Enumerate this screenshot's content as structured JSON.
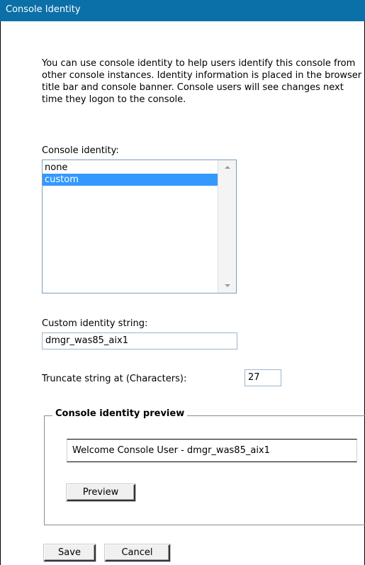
{
  "window": {
    "title": "Console Identity"
  },
  "intro_text": "You can use console identity to help users identify this console from other console instances. Identity information is placed in the browser title bar and console banner. Console users will see changes next time they logon to the console.",
  "identity": {
    "label": "Console identity:",
    "options": [
      "none",
      "custom"
    ],
    "selected": "custom"
  },
  "custom_string": {
    "label": "Custom identity string:",
    "value": "dmgr_was85_aix1"
  },
  "truncate": {
    "label": "Truncate string at (Characters):",
    "value": "27"
  },
  "preview": {
    "legend": "Console identity preview",
    "text": "Welcome Console User - dmgr_was85_aix1",
    "button_label": "Preview"
  },
  "actions": {
    "save_label": "Save",
    "cancel_label": "Cancel"
  },
  "colors": {
    "titlebar": "#0b6fa8",
    "selection": "#3399ff"
  }
}
